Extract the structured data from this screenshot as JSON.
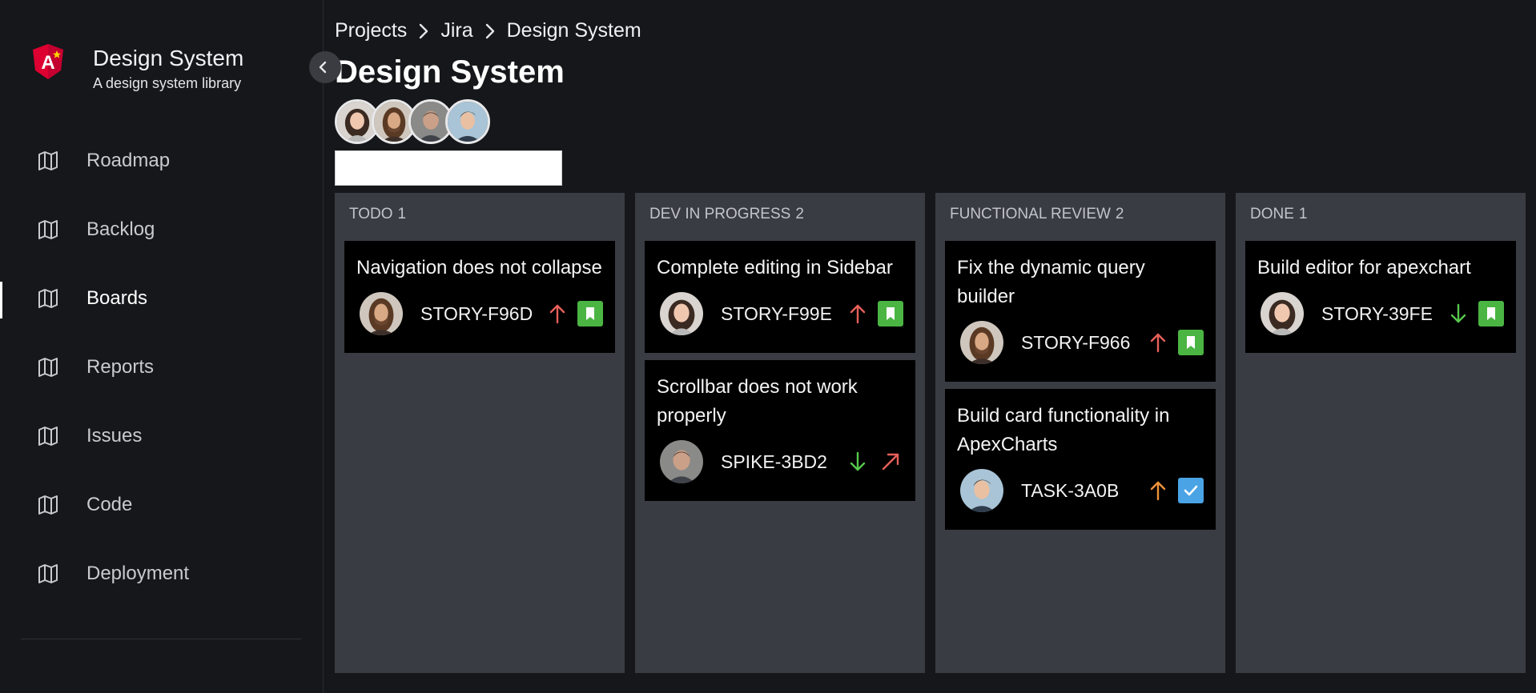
{
  "brand": {
    "title": "Design System",
    "subtitle": "A design system library",
    "logo_icon": "angular-shield-icon",
    "logo_color": "#dd0031"
  },
  "sidebar": {
    "items": [
      {
        "label": "Roadmap",
        "icon": "map-icon",
        "active": false
      },
      {
        "label": "Backlog",
        "icon": "map-icon",
        "active": false
      },
      {
        "label": "Boards",
        "icon": "map-icon",
        "active": true
      },
      {
        "label": "Reports",
        "icon": "map-icon",
        "active": false
      },
      {
        "label": "Issues",
        "icon": "map-icon",
        "active": false
      },
      {
        "label": "Code",
        "icon": "map-icon",
        "active": false
      },
      {
        "label": "Deployment",
        "icon": "map-icon",
        "active": false
      }
    ]
  },
  "breadcrumb": [
    "Projects",
    "Jira",
    "Design System"
  ],
  "page": {
    "title": "Design System"
  },
  "search": {
    "value": "",
    "placeholder": ""
  },
  "colors": {
    "priority_high": "#e8605a",
    "priority_medium": "#f0923a",
    "priority_low": "#57c84d",
    "story": "#4bb543",
    "task": "#4aa3e4"
  },
  "columns": [
    {
      "name": "TODO",
      "count": "1",
      "cards": [
        {
          "title": "Navigation does not collapse",
          "id": "STORY-F96D",
          "priority": "high",
          "type": "story"
        }
      ]
    },
    {
      "name": "DEV IN PROGRESS",
      "count": "2",
      "cards": [
        {
          "title": "Complete editing in Sidebar",
          "id": "STORY-F99E",
          "priority": "high",
          "type": "story"
        },
        {
          "title": "Scrollbar does not work properly",
          "id": "SPIKE-3BD2",
          "priority": "low",
          "type": "spike"
        }
      ]
    },
    {
      "name": "FUNCTIONAL REVIEW",
      "count": "2",
      "cards": [
        {
          "title": "Fix the dynamic query builder",
          "id": "STORY-F966",
          "priority": "high",
          "type": "story"
        },
        {
          "title": "Build card functionality in ApexCharts",
          "id": "TASK-3A0B",
          "priority": "medium",
          "type": "task"
        }
      ]
    },
    {
      "name": "DONE",
      "count": "1",
      "cards": [
        {
          "title": "Build editor for apexchart",
          "id": "STORY-39FE",
          "priority": "low",
          "type": "story"
        }
      ]
    }
  ]
}
